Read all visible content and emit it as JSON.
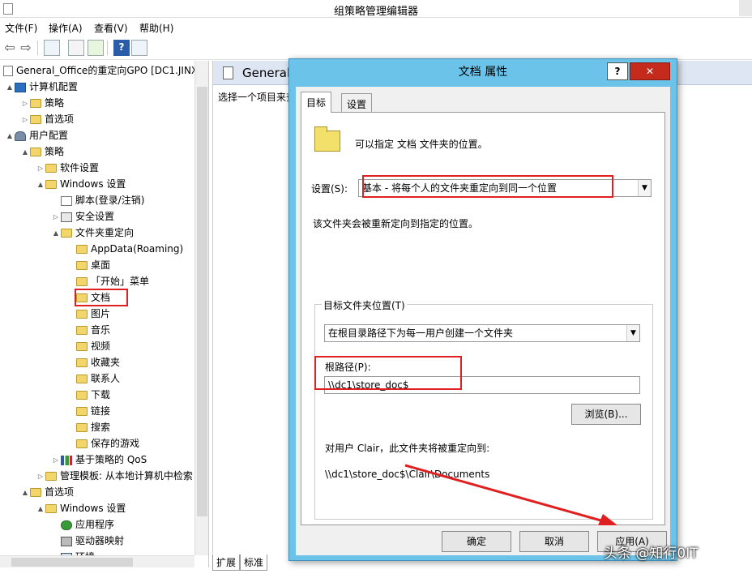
{
  "window": {
    "title": "组策略管理编辑器"
  },
  "menu": [
    "文件(F)",
    "操作(A)",
    "查看(V)",
    "帮助(H)"
  ],
  "tree": {
    "root": "General_Office的重定向GPO [DC1.JINX",
    "items": [
      {
        "label": "计算机配置",
        "level": 0,
        "expand": "▲",
        "icon": "computer-icon"
      },
      {
        "label": "策略",
        "level": 1,
        "expand": "▷",
        "icon": "folder-icon"
      },
      {
        "label": "首选项",
        "level": 1,
        "expand": "▷",
        "icon": "folder-icon"
      },
      {
        "label": "用户配置",
        "level": 0,
        "expand": "▲",
        "icon": "users-icon"
      },
      {
        "label": "策略",
        "level": 1,
        "expand": "▲",
        "icon": "folder-icon"
      },
      {
        "label": "软件设置",
        "level": 2,
        "expand": "▷",
        "icon": "folder-icon"
      },
      {
        "label": "Windows 设置",
        "level": 2,
        "expand": "▲",
        "icon": "folder-icon"
      },
      {
        "label": "脚本(登录/注销)",
        "level": 3,
        "expand": "",
        "icon": "script-icon"
      },
      {
        "label": "安全设置",
        "level": 3,
        "expand": "▷",
        "icon": "security-icon"
      },
      {
        "label": "文件夹重定向",
        "level": 3,
        "expand": "▲",
        "icon": "folder-icon"
      },
      {
        "label": "AppData(Roaming)",
        "level": 4,
        "expand": "",
        "icon": "folder-icon"
      },
      {
        "label": "桌面",
        "level": 4,
        "expand": "",
        "icon": "folder-icon"
      },
      {
        "label": "「开始」菜单",
        "level": 4,
        "expand": "",
        "icon": "folder-icon"
      },
      {
        "label": "文档",
        "level": 4,
        "expand": "",
        "icon": "folder-icon"
      },
      {
        "label": "图片",
        "level": 4,
        "expand": "",
        "icon": "folder-icon"
      },
      {
        "label": "音乐",
        "level": 4,
        "expand": "",
        "icon": "folder-icon"
      },
      {
        "label": "视频",
        "level": 4,
        "expand": "",
        "icon": "folder-icon"
      },
      {
        "label": "收藏夹",
        "level": 4,
        "expand": "",
        "icon": "folder-icon"
      },
      {
        "label": "联系人",
        "level": 4,
        "expand": "",
        "icon": "folder-icon"
      },
      {
        "label": "下载",
        "level": 4,
        "expand": "",
        "icon": "folder-icon"
      },
      {
        "label": "链接",
        "level": 4,
        "expand": "",
        "icon": "folder-icon"
      },
      {
        "label": "搜索",
        "level": 4,
        "expand": "",
        "icon": "folder-icon"
      },
      {
        "label": "保存的游戏",
        "level": 4,
        "expand": "",
        "icon": "folder-icon"
      },
      {
        "label": "基于策略的 QoS",
        "level": 3,
        "expand": "▷",
        "icon": "chart-icon"
      },
      {
        "label": "管理模板: 从本地计算机中检索",
        "level": 2,
        "expand": "▷",
        "icon": "folder-icon"
      },
      {
        "label": "首选项",
        "level": 1,
        "expand": "▲",
        "icon": "folder-icon"
      },
      {
        "label": "Windows 设置",
        "level": 2,
        "expand": "▲",
        "icon": "folder-icon"
      },
      {
        "label": "应用程序",
        "level": 3,
        "expand": "",
        "icon": "app-icon"
      },
      {
        "label": "驱动器映射",
        "level": 3,
        "expand": "",
        "icon": "drive-icon"
      },
      {
        "label": "环境",
        "level": 3,
        "expand": "",
        "icon": "env-icon"
      }
    ]
  },
  "right_panel": {
    "header": "General_",
    "hint": "选择一个项目来查"
  },
  "bottom_tabs": [
    "扩展",
    "标准"
  ],
  "dialog": {
    "title": "文档 属性",
    "help": "?",
    "close": "✕",
    "tabs": [
      "目标",
      "设置"
    ],
    "intro": "可以指定 文档 文件夹的位置。",
    "setting_label": "设置(S):",
    "setting_value": "基本 - 将每个人的文件夹重定向到同一个位置",
    "setting_desc": "该文件夹会被重新定向到指定的位置。",
    "target_group": "目标文件夹位置(T)",
    "target_value": "在根目录路径下为每一用户创建一个文件夹",
    "root_label": "根路径(P):",
    "root_value": "\\\\dc1\\store_doc$",
    "browse": "浏览(B)...",
    "user_note": "对用户 Clair，此文件夹将被重定向到:",
    "redirect_path": "\\\\dc1\\store_doc$\\Clair\\Documents",
    "ok": "确定",
    "cancel": "取消",
    "apply": "应用(A)"
  },
  "watermark": "头条 @知行0IT",
  "colors": {
    "dialog_frame": "#6bc3ea",
    "annotation_red": "#e02020",
    "close_red": "#c42b1c"
  }
}
